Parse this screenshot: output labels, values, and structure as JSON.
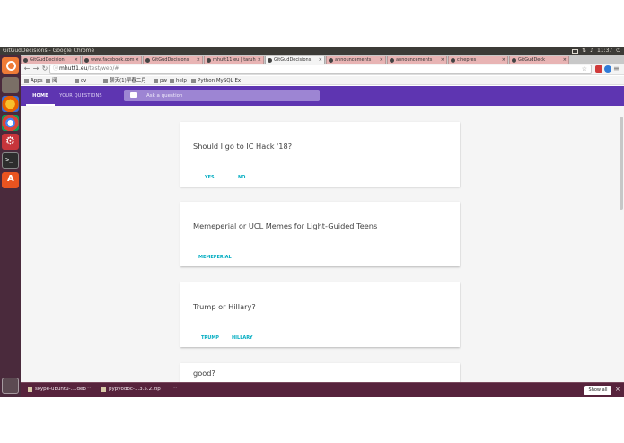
{
  "os": {
    "window_title": "GitGudDecisions - Google Chrome",
    "time": "11:37"
  },
  "launcher": {
    "items": [
      "dash-home-icon",
      "files-icon",
      "firefox-icon",
      "chrome-icon",
      "settings-icon",
      "terminal-icon",
      "software-center-icon",
      "trash-icon"
    ]
  },
  "browser": {
    "tabs": [
      {
        "label": "GitGudDecision"
      },
      {
        "label": "www.facebook.com"
      },
      {
        "label": "GitGudDecisions"
      },
      {
        "label": "mhutt11.eu | taruh"
      },
      {
        "label": "GitGudDecisions"
      },
      {
        "label": "announcements"
      },
      {
        "label": "announcements"
      },
      {
        "label": "cinepres"
      },
      {
        "label": "GitGudDeck"
      }
    ],
    "url_host": "mhutt1.eu",
    "url_path": "/test/web/#",
    "bookmarks": [
      "Apps",
      "阅",
      "cv",
      "pw",
      "help",
      "Python MySQL Ex"
    ],
    "bookmark_extra": "聊天(1)早春二月"
  },
  "app": {
    "nav": {
      "home": "HOME",
      "your_questions": "YOUR QUESTIONS"
    },
    "search": {
      "placeholder": "Ask a question"
    },
    "cards": [
      {
        "title": "Should I go to IC Hack '18?",
        "options": [
          "YES",
          "NO"
        ]
      },
      {
        "title": "Memeperial or UCL Memes for Light-Guided Teens",
        "options": [
          "MEMEPERIAL"
        ]
      },
      {
        "title": "Trump or Hillary?",
        "options": [
          "TRUMP",
          "HILLARY"
        ]
      },
      {
        "title": "good?",
        "options": []
      }
    ]
  },
  "downloads": {
    "items": [
      "skype-ubuntu-....deb",
      "pypyodbc-1.3.5.2.zip"
    ],
    "show_all": "Show all"
  },
  "colors": {
    "appbar": "#5e35b1",
    "accent": "#00acc1",
    "desktop": "#2c001e"
  }
}
